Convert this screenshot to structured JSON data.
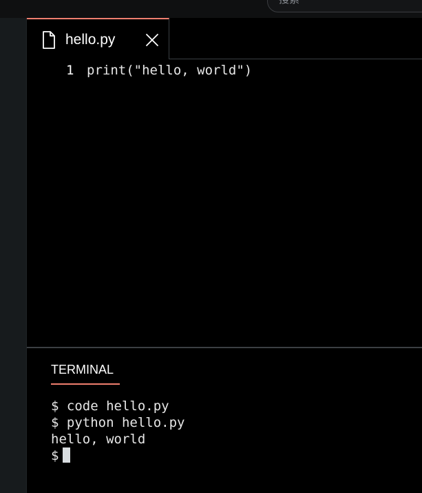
{
  "search": {
    "placeholder": "搜索"
  },
  "editor": {
    "tab": {
      "label": "hello.py",
      "file_icon": "file-icon",
      "close_icon": "close-icon"
    },
    "lines": [
      {
        "number": "1",
        "text": "print(\"hello, world\")"
      }
    ]
  },
  "panel": {
    "tab_label": "TERMINAL",
    "terminal_lines": [
      "$ code hello.py",
      "$ python hello.py",
      "hello, world"
    ],
    "prompt": "$"
  },
  "colors": {
    "accent": "#f07f6f",
    "background": "#000000",
    "sidebar": "#171b1d",
    "text": "#e6e6e6"
  }
}
